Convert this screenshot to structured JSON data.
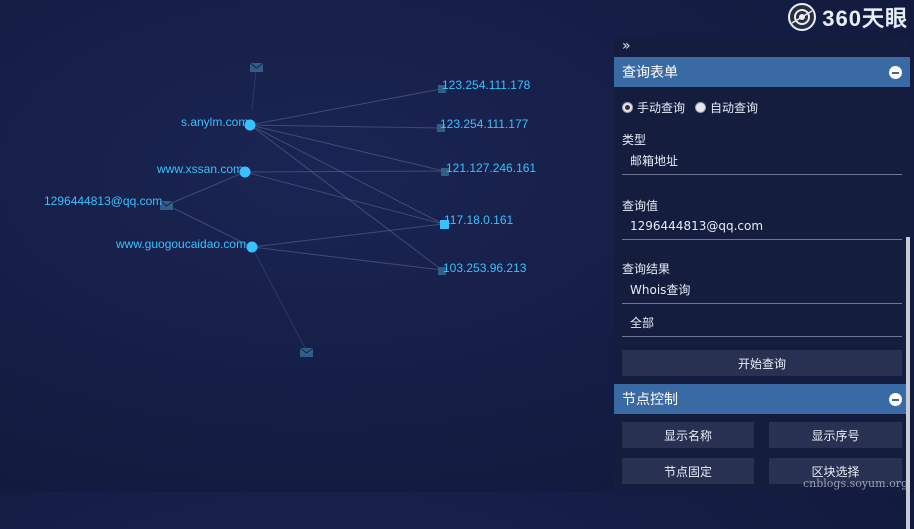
{
  "brand": {
    "name": "360天眼"
  },
  "graph": {
    "domain_nodes": [
      {
        "label": "s.anylm.com",
        "color": "#37c2ff"
      },
      {
        "label": "www.xssan.com",
        "color": "#37c2ff"
      },
      {
        "label": "www.guogoucaidao.com",
        "color": "#37c2ff"
      }
    ],
    "email_nodes": [
      {
        "label": "1296444813@qq.com",
        "icon": "mail-icon"
      },
      {
        "label": "",
        "icon": "mail-icon"
      },
      {
        "label": "",
        "icon": "mail-icon"
      }
    ],
    "ip_nodes": [
      {
        "label": "123.254.111.178"
      },
      {
        "label": "123.254.111.177"
      },
      {
        "label": "121.127.246.161"
      },
      {
        "label": "117.18.0.161"
      },
      {
        "label": "103.253.96.213"
      }
    ],
    "colors": {
      "domain": "#37c2ff",
      "ip_highlight": "#37c2ff",
      "ip_dim": "#2f5f86",
      "label": "#37c2ff"
    }
  },
  "panel": {
    "collapse_icon": "double-chevron-right-icon",
    "query_form": {
      "title": "查询表单",
      "modes": [
        {
          "label": "手动查询",
          "checked": true
        },
        {
          "label": "自动查询",
          "checked": false
        }
      ],
      "type_label": "类型",
      "type_value": "邮箱地址",
      "query_value_label": "查询值",
      "query_value": "1296444813@qq.com",
      "result_label": "查询结果",
      "result_option_1": "Whois查询",
      "result_option_2": "全部",
      "start_button": "开始查询"
    },
    "node_control": {
      "title": "节点控制",
      "buttons": [
        "显示名称",
        "显示序号",
        "节点固定",
        "区块选择"
      ]
    }
  },
  "watermark": "cnblogs.soyum.org"
}
